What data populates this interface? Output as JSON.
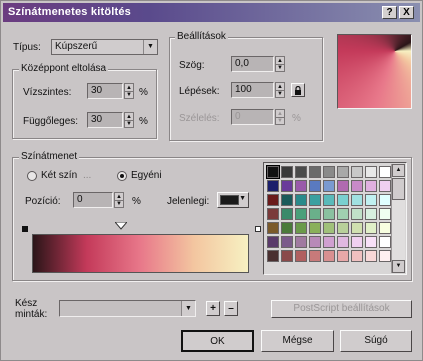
{
  "window": {
    "title": "Színátmenetes kitöltés",
    "help_button": "?",
    "close_button": "X"
  },
  "type": {
    "label": "Típus:",
    "value": "Kúpszerű"
  },
  "center_offset": {
    "group_title": "Középpont eltolása",
    "horizontal_label": "Vízszintes:",
    "horizontal_value": "30",
    "vertical_label": "Függőleges:",
    "vertical_value": "30",
    "unit": "%"
  },
  "settings": {
    "group_title": "Beállítások",
    "angle_label": "Szög:",
    "angle_value": "0,0",
    "steps_label": "Lépések:",
    "steps_value": "100",
    "margin_label": "Szélelés:",
    "margin_value": "0",
    "margin_unit": "%"
  },
  "gradient": {
    "group_title": "Színátmenet",
    "two_color_label": "Két szín",
    "custom_label": "Egyéni",
    "position_label": "Pozíció:",
    "position_value": "0",
    "position_unit": "%",
    "current_label": "Jelenlegi:",
    "current_color": "#1a1a1a",
    "selected_mode": "custom"
  },
  "presets": {
    "label_line1": "Kész",
    "label_line2": "minták:",
    "value": "",
    "add_button": "+",
    "remove_button": "–",
    "postscript_button": "PostScript beállítások"
  },
  "footer": {
    "ok_label": "OK",
    "cancel_label": "Mégse",
    "help_label": "Súgó"
  },
  "colors": {
    "gradient_stops": [
      "#2a1518",
      "#c43a5a",
      "#e8788a",
      "#f3c6a0",
      "#f7f1c2"
    ],
    "palette": [
      "#111111",
      "#3a3a3a",
      "#4a4a4a",
      "#6a6a6a",
      "#8a8a8a",
      "#a8a8a8",
      "#c8c8c8",
      "#e8e8e8",
      "#ffffff",
      "#1b1f6b",
      "#6a3a9a",
      "#9a5aaa",
      "#5a7ac0",
      "#7a9ad0",
      "#b06ab0",
      "#c88ac8",
      "#e0b0e0",
      "#f0d0f0",
      "#6a1a1a",
      "#1a5a5a",
      "#2a8a8a",
      "#3aa0a0",
      "#5ababa",
      "#7ad0d0",
      "#a0e0e0",
      "#c0f0f0",
      "#e0ffff",
      "#7a3a3a",
      "#3a8a6a",
      "#4aa07a",
      "#6ab08a",
      "#8ac0a0",
      "#a0d0b0",
      "#c0e0c8",
      "#d8f0e0",
      "#f0fff0",
      "#7a5a2a",
      "#4a7a3a",
      "#6a9a4a",
      "#8ab05a",
      "#a0c07a",
      "#b8d09a",
      "#d0e0b0",
      "#e0f0c8",
      "#f8ffe0",
      "#5a3a6a",
      "#7a5a8a",
      "#a07aa0",
      "#b88ab8",
      "#d0a0d0",
      "#e0b8e0",
      "#f0d0f0",
      "#f8e0f8",
      "#ffffff",
      "#4a3030",
      "#8a4a4a",
      "#b06060",
      "#c87a7a",
      "#d89090",
      "#e8a8a8",
      "#f0c0c0",
      "#f8d8d8",
      "#fff0f0"
    ]
  }
}
